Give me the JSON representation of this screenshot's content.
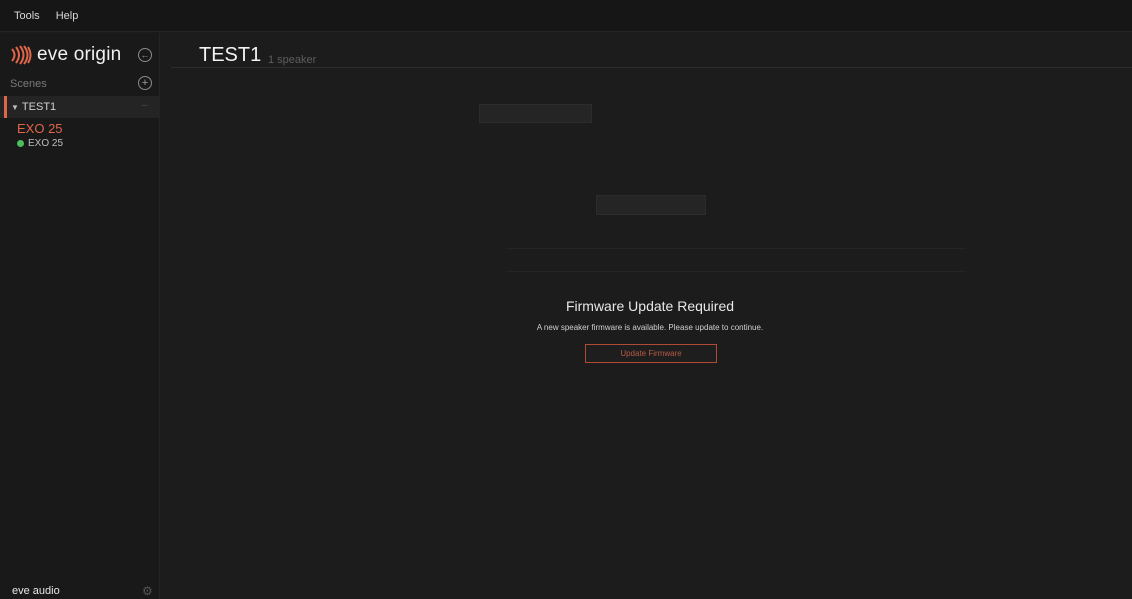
{
  "menubar": {
    "tools": "Tools",
    "help": "Help"
  },
  "sidebar": {
    "brand": "eve origin",
    "scenes_label": "Scenes",
    "scene": {
      "name": "TEST1",
      "menu": "–"
    },
    "device": {
      "name": "EXO 25",
      "status_label": "EXO 25",
      "status_color": "#4cbf5a"
    },
    "footer": "eve audio"
  },
  "main": {
    "title": "TEST1",
    "subtitle": "1 speaker"
  },
  "modal": {
    "title": "Firmware Update Required",
    "message": "A new speaker firmware is available. Please update to continue.",
    "button": "Update Firmware"
  },
  "colors": {
    "accent": "#e0664a",
    "background": "#1c1c1c",
    "status_ok": "#4cbf5a"
  },
  "icons": {
    "collapse": "collapse-left-icon",
    "add": "add-circle-icon",
    "settings": "gear-icon"
  }
}
